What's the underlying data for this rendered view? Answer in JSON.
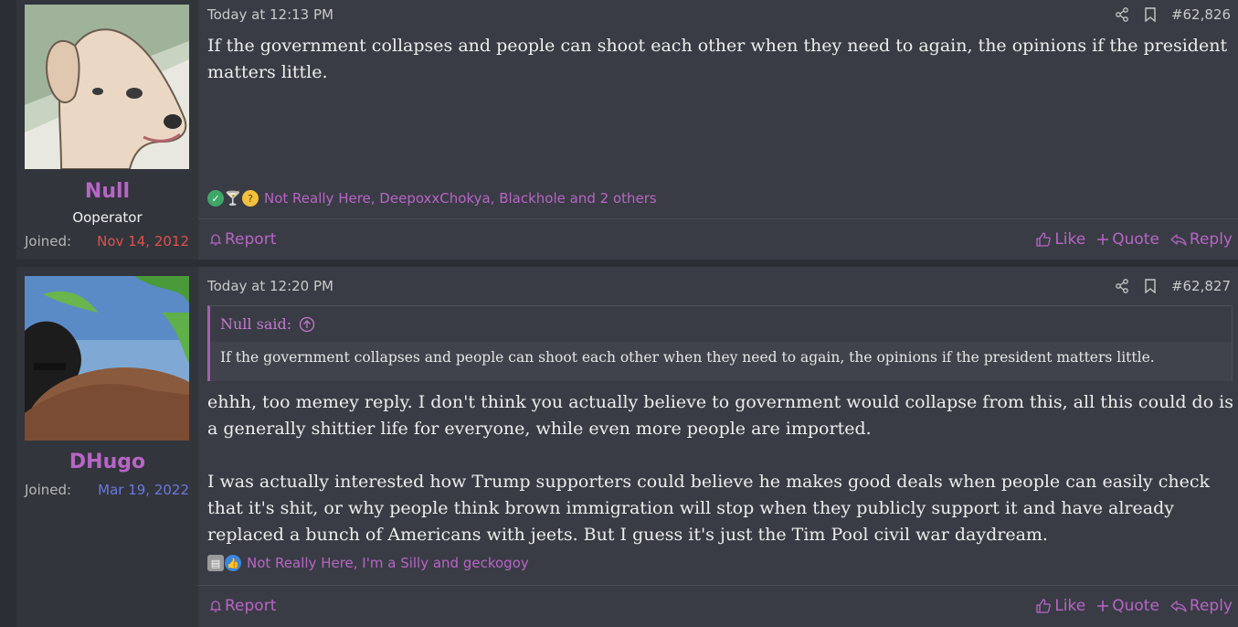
{
  "posts": [
    {
      "username": "Null",
      "user_title": "Ooperator",
      "joined_label": "Joined:",
      "joined_date": "Nov 14, 2012",
      "timestamp": "Today at 12:13 PM",
      "post_number": "#62,826",
      "body": "If the government collapses and people can shoot each other when they need to again, the opinions if the president matters little.",
      "reactions_text": "Not Really Here, DeepoxxChokya, Blackhole and 2 others",
      "reaction_icons": [
        "check-icon",
        "cocktail-icon",
        "thinking-icon"
      ],
      "report_label": "Report",
      "like_label": "Like",
      "quote_label": "Quote",
      "reply_label": "Reply"
    },
    {
      "username": "DHugo",
      "joined_label": "Joined:",
      "joined_date": "Mar 19, 2022",
      "timestamp": "Today at 12:20 PM",
      "post_number": "#62,827",
      "quote_author": "Null said:",
      "quote_text": "If the government collapses and people can shoot each other when they need to again, the opinions if the president matters little.",
      "body_paragraphs": [
        "ehhh, too memey reply. I don't think you actually believe to government would collapse from this, all this could do is a generally shittier life for everyone, while even more people are imported.",
        "I was actually interested how Trump supporters could believe he makes good deals when people can easily check that it's shit, or why people think brown immigration will stop when they publicly support it and have already replaced a bunch of Americans with jeets. But I guess it's just the Tim Pool civil war daydream."
      ],
      "reactions_text": "Not Really Here, I'm a Silly and geckogoy",
      "reaction_icons": [
        "newspaper-icon",
        "thumbs-up-icon"
      ],
      "report_label": "Report",
      "like_label": "Like",
      "quote_label": "Quote",
      "reply_label": "Reply"
    }
  ],
  "colors": {
    "accent": "#b865c6",
    "background": "#2b2e35",
    "post_bg": "#393c44",
    "user_panel_bg": "#32353c",
    "joined_red": "#e0514b",
    "joined_blue": "#6b78e0"
  }
}
